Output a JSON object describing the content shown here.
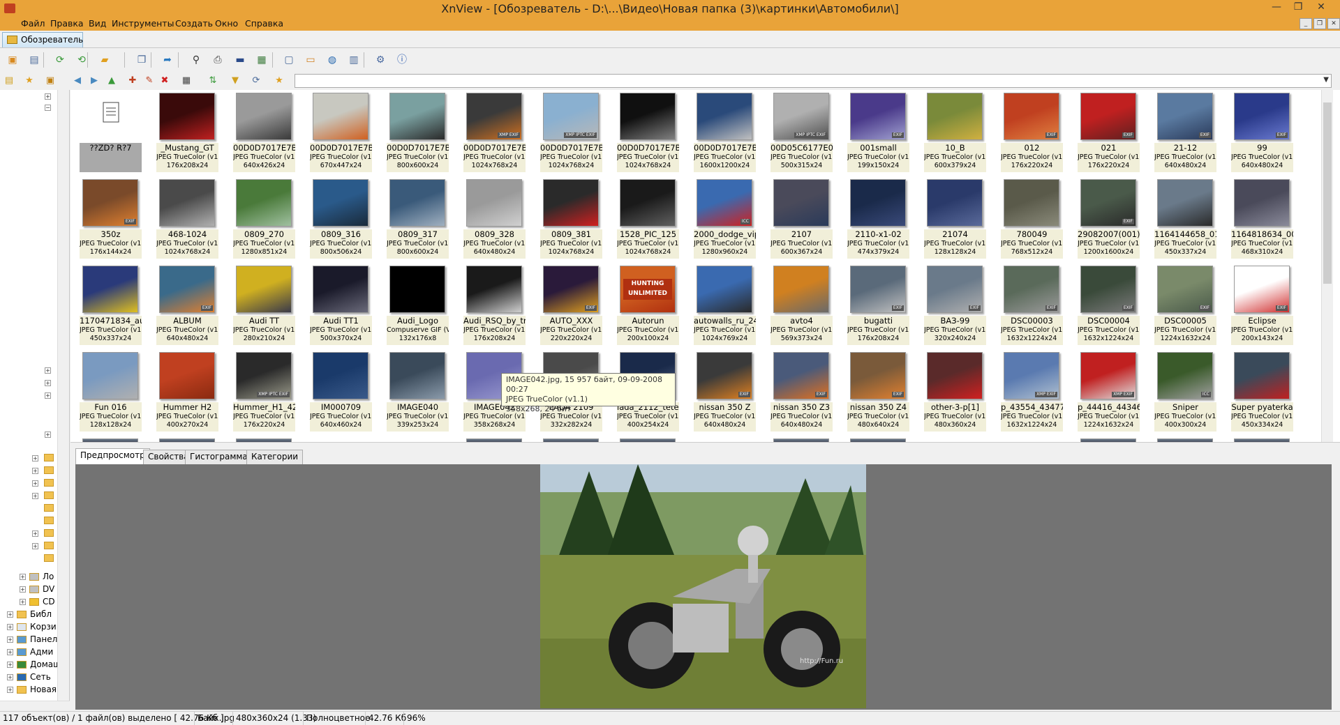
{
  "window": {
    "title": "XnView - [Обозреватель - D:\\...\\Видео\\Новая папка (3)\\картинки\\Автомобили\\]",
    "min": "—",
    "max": "❐",
    "close": "✕"
  },
  "menu": [
    "Файл",
    "Правка",
    "Вид",
    "Инструменты",
    "Создать",
    "Окно",
    "Справка"
  ],
  "mdi": {
    "min": "_",
    "restore": "❐",
    "close": "✕"
  },
  "tab": {
    "label": "Обозреватель"
  },
  "toolbar1": [
    {
      "name": "open-browser-icon",
      "glyph": "▣",
      "color": "#d88a20"
    },
    {
      "name": "fullscreen-icon",
      "glyph": "▤",
      "color": "#4a6a9a"
    },
    {
      "name": "refresh-icon",
      "glyph": "⟳",
      "color": "#3a9a3a"
    },
    {
      "name": "refresh-alt-icon",
      "glyph": "⟲",
      "color": "#3a9a3a"
    },
    {
      "name": "folder-open-icon",
      "glyph": "▰",
      "color": "#e0a020"
    },
    {
      "name": "copy-icon",
      "glyph": "❐",
      "color": "#4a6a9a"
    },
    {
      "name": "export-icon",
      "glyph": "➦",
      "color": "#2a7ac0"
    },
    {
      "name": "binoculars-icon",
      "glyph": "⚲",
      "color": "#333"
    },
    {
      "name": "print-icon",
      "glyph": "⎙",
      "color": "#444"
    },
    {
      "name": "scanner-icon",
      "glyph": "▬",
      "color": "#2a4a8a"
    },
    {
      "name": "slideshow-icon",
      "glyph": "▦",
      "color": "#3a7a3a"
    },
    {
      "name": "capture-icon",
      "glyph": "▢",
      "color": "#4a6a9a"
    },
    {
      "name": "monitor-icon",
      "glyph": "▭",
      "color": "#d08020"
    },
    {
      "name": "web-icon",
      "glyph": "◍",
      "color": "#2a6ab0"
    },
    {
      "name": "settings-grid-icon",
      "glyph": "▥",
      "color": "#4a6a9a"
    },
    {
      "name": "gear-icon",
      "glyph": "⚙",
      "color": "#4a6aa0"
    },
    {
      "name": "info-icon",
      "glyph": "ⓘ",
      "color": "#2a5ab0"
    }
  ],
  "toolbar2": [
    {
      "name": "tree-folders-icon",
      "glyph": "▤",
      "color": "#d0a020"
    },
    {
      "name": "favorites-icon",
      "glyph": "★",
      "color": "#e0a020"
    },
    {
      "name": "categories-icon",
      "glyph": "▣",
      "color": "#c08010"
    },
    {
      "name": "back-icon",
      "glyph": "◀",
      "color": "#4a8ac0"
    },
    {
      "name": "forward-icon",
      "glyph": "▶",
      "color": "#4a8ac0"
    },
    {
      "name": "up-icon",
      "glyph": "▲",
      "color": "#3a9a3a"
    },
    {
      "name": "new-folder-icon",
      "glyph": "✚",
      "color": "#c04020"
    },
    {
      "name": "rename-icon",
      "glyph": "✎",
      "color": "#c04020"
    },
    {
      "name": "delete-icon",
      "glyph": "✖",
      "color": "#d02020"
    },
    {
      "name": "view-mode-icon",
      "glyph": "▦",
      "color": "#444"
    },
    {
      "name": "sort-icon",
      "glyph": "⇅",
      "color": "#3a9a3a"
    },
    {
      "name": "filter-icon",
      "glyph": "▼",
      "color": "#d0a020"
    },
    {
      "name": "sync-icon",
      "glyph": "⟳",
      "color": "#4a6a9a"
    },
    {
      "name": "rating-icon",
      "glyph": "★",
      "color": "#e0a020"
    }
  ],
  "sidebar": {
    "items": [
      {
        "label": "Ло",
        "icon": "drive"
      },
      {
        "label": "DV",
        "icon": "drive"
      },
      {
        "label": "CD",
        "icon": "cd"
      },
      {
        "label": "Библ",
        "icon": "folder"
      },
      {
        "label": "Корзи",
        "icon": "bin"
      },
      {
        "label": "Панел",
        "icon": "panel"
      },
      {
        "label": "Адми",
        "icon": "panel"
      },
      {
        "label": "Домаш",
        "icon": "home"
      },
      {
        "label": "Сеть",
        "icon": "network"
      },
      {
        "label": "Новая",
        "icon": "folder"
      }
    ]
  },
  "files": [
    {
      "name": "??ZD? R?7",
      "fmt": "",
      "dim": "",
      "c1": "#ffffff",
      "c2": "#ffffff",
      "doc": true,
      "sel": true
    },
    {
      "name": "_Mustang_GT",
      "fmt": "JPEG TrueColor (v1.2)",
      "dim": "176x208x24",
      "c1": "#3a0a0a",
      "c2": "#c02020"
    },
    {
      "name": "00D0D7017E7B_2...",
      "fmt": "JPEG TrueColor (v1.1)",
      "dim": "640x426x24",
      "c1": "#9a9a9a",
      "c2": "#3a3a3a"
    },
    {
      "name": "00D0D7017E7B_2...",
      "fmt": "JPEG TrueColor (v1.2)",
      "dim": "670x447x24",
      "c1": "#c8c8c0",
      "c2": "#d06020"
    },
    {
      "name": "00D0D7017E7B_2...",
      "fmt": "JPEG TrueColor (v1.2)",
      "dim": "800x600x24",
      "c1": "#7aa0a0",
      "c2": "#2a2a2a"
    },
    {
      "name": "00D0D7017E7B_2...",
      "fmt": "JPEG TrueColor (v1.1)",
      "dim": "1024x768x24",
      "c1": "#3a3a3a",
      "c2": "#d07020",
      "badge": "XMP EXIF"
    },
    {
      "name": "00D0D7017E7B_2...",
      "fmt": "JPEG TrueColor (v1.1)",
      "dim": "1024x768x24",
      "c1": "#8ab0d0",
      "c2": "#b8b8b8",
      "badge": "XMP IPTC EXIF"
    },
    {
      "name": "00D0D7017E7B_2...",
      "fmt": "JPEG TrueColor (v1.1)",
      "dim": "1024x768x24",
      "c1": "#101010",
      "c2": "#808080"
    },
    {
      "name": "00D0D7017E7B_2...",
      "fmt": "JPEG TrueColor (v1.1)",
      "dim": "1600x1200x24",
      "c1": "#2a4a7a",
      "c2": "#c0c0c0"
    },
    {
      "name": "00D05C6177E0_8...",
      "fmt": "JPEG TrueColor (v1.2)",
      "dim": "500x315x24",
      "c1": "#b0b0b0",
      "c2": "#505050",
      "badge": "XMP IPTC EXIF"
    },
    {
      "name": "001small",
      "fmt": "JPEG TrueColor (v1.1)",
      "dim": "199x150x24",
      "c1": "#4a3a8a",
      "c2": "#a0a0d0",
      "badge": "EXIF"
    },
    {
      "name": "10_B",
      "fmt": "JPEG TrueColor (v1.1)",
      "dim": "600x379x24",
      "c1": "#7a8a3a",
      "c2": "#d0b040"
    },
    {
      "name": "012",
      "fmt": "JPEG TrueColor (v1.1)",
      "dim": "176x220x24",
      "c1": "#c04020",
      "c2": "#e08040",
      "badge": "EXIF"
    },
    {
      "name": "021",
      "fmt": "JPEG TrueColor (v1.1)",
      "dim": "176x220x24",
      "c1": "#c02020",
      "c2": "#602020",
      "badge": "EXIF"
    },
    {
      "name": "21-12",
      "fmt": "JPEG TrueColor (v1.1)",
      "dim": "640x480x24",
      "c1": "#5a7aa0",
      "c2": "#2a3a5a",
      "badge": "EXIF"
    },
    {
      "name": "99",
      "fmt": "JPEG TrueColor (v1.1)",
      "dim": "640x480x24",
      "c1": "#2a3a8a",
      "c2": "#6a7ad0",
      "badge": "EXIF"
    },
    {
      "name": "350z",
      "fmt": "JPEG TrueColor (v1.1)",
      "dim": "176x144x24",
      "c1": "#7a4a2a",
      "c2": "#e08030",
      "badge": "EXIF"
    },
    {
      "name": "468-1024",
      "fmt": "JPEG TrueColor (v1.1)",
      "dim": "1024x768x24",
      "c1": "#4a4a4a",
      "c2": "#b0b0b0"
    },
    {
      "name": "0809_270",
      "fmt": "JPEG TrueColor (v1.1)",
      "dim": "1280x851x24",
      "c1": "#4a7a3a",
      "c2": "#a0c0a0"
    },
    {
      "name": "0809_316",
      "fmt": "JPEG TrueColor (v1.2)",
      "dim": "800x506x24",
      "c1": "#2a5a8a",
      "c2": "#1a2a3a"
    },
    {
      "name": "0809_317",
      "fmt": "JPEG TrueColor (v1.2)",
      "dim": "800x600x24",
      "c1": "#3a5a7a",
      "c2": "#a0b0c0"
    },
    {
      "name": "0809_328",
      "fmt": "JPEG TrueColor (v1.1)",
      "dim": "640x480x24",
      "c1": "#9a9a9a",
      "c2": "#d0d0d0"
    },
    {
      "name": "0809_381",
      "fmt": "JPEG TrueColor (v1.1)",
      "dim": "1024x768x24",
      "c1": "#2a2a2a",
      "c2": "#d02020"
    },
    {
      "name": "1528_PIC_125",
      "fmt": "JPEG TrueColor (v1.1)",
      "dim": "1024x768x24",
      "c1": "#1a1a1a",
      "c2": "#606060"
    },
    {
      "name": "2000_dodge_vip...",
      "fmt": "JPEG TrueColor (v1.1)",
      "dim": "1280x960x24",
      "c1": "#3a6ab0",
      "c2": "#d02020",
      "badge": "ICC"
    },
    {
      "name": "2107",
      "fmt": "JPEG TrueColor (v1.1)",
      "dim": "600x367x24",
      "c1": "#4a4a5a",
      "c2": "#2a3a5a"
    },
    {
      "name": "2110-x1-02",
      "fmt": "JPEG TrueColor (v1.1)",
      "dim": "474x379x24",
      "c1": "#1a2a4a",
      "c2": "#3a4a7a"
    },
    {
      "name": "21074",
      "fmt": "JPEG TrueColor (v1.1)",
      "dim": "128x128x24",
      "c1": "#2a3a6a",
      "c2": "#5a6a9a"
    },
    {
      "name": "780049",
      "fmt": "JPEG TrueColor (v1.1)",
      "dim": "768x512x24",
      "c1": "#5a5a4a",
      "c2": "#8a8a7a"
    },
    {
      "name": "29082007(001)",
      "fmt": "JPEG TrueColor (v1.1)",
      "dim": "1200x1600x24",
      "c1": "#4a5a4a",
      "c2": "#2a2a2a",
      "badge": "EXIF"
    },
    {
      "name": "1164144658_01_v...",
      "fmt": "JPEG TrueColor (v1.1)",
      "dim": "450x337x24",
      "c1": "#6a7a8a",
      "c2": "#2a2a2a"
    },
    {
      "name": "1164818634_0090...",
      "fmt": "JPEG TrueColor (v1.2)",
      "dim": "468x310x24",
      "c1": "#4a4a5a",
      "c2": "#8a8a9a"
    },
    {
      "name": "1170471834_auto...",
      "fmt": "JPEG TrueColor (v1.1)",
      "dim": "450x337x24",
      "c1": "#2a3a7a",
      "c2": "#e0c020"
    },
    {
      "name": "ALBUM",
      "fmt": "JPEG TrueColor (v1.1)",
      "dim": "640x480x24",
      "c1": "#3a6a8a",
      "c2": "#e08030",
      "badge": "EXIF"
    },
    {
      "name": "Audi TT",
      "fmt": "JPEG TrueColor (v1.1)",
      "dim": "280x210x24",
      "c1": "#d0b020",
      "c2": "#3a3a4a"
    },
    {
      "name": "Audi TT1",
      "fmt": "JPEG TrueColor (v1.1)",
      "dim": "500x370x24",
      "c1": "#1a1a2a",
      "c2": "#6a6a7a"
    },
    {
      "name": "Audi_Logo",
      "fmt": "Compuserve GIF (V...",
      "dim": "132x176x8",
      "c1": "#000000",
      "c2": "#000000"
    },
    {
      "name": "Audi_RSQ_by_tr...",
      "fmt": "JPEG TrueColor (v1.1)",
      "dim": "176x208x24",
      "c1": "#1a1a1a",
      "c2": "#d0d0d0"
    },
    {
      "name": "AUTO_XXX",
      "fmt": "JPEG TrueColor (v1.1)",
      "dim": "220x220x24",
      "c1": "#2a1a3a",
      "c2": "#e0a020",
      "badge": "EXIF"
    },
    {
      "name": "Autorun",
      "fmt": "JPEG TrueColor (v1.1)",
      "dim": "200x100x24",
      "c1": "#d06020",
      "c2": "#b03010",
      "hunt": true
    },
    {
      "name": "autowalls_ru_242",
      "fmt": "JPEG TrueColor (v1.1)",
      "dim": "1024x769x24",
      "c1": "#3a6ab0",
      "c2": "#2a2a2a"
    },
    {
      "name": "avto4",
      "fmt": "JPEG TrueColor (v1.1)",
      "dim": "569x373x24",
      "c1": "#d08020",
      "c2": "#6a6a6a"
    },
    {
      "name": "bugatti",
      "fmt": "JPEG TrueColor (v1.2)",
      "dim": "176x208x24",
      "c1": "#5a6a7a",
      "c2": "#c0c0c0",
      "badge": "EXIF"
    },
    {
      "name": "ВАЗ-99",
      "fmt": "JPEG TrueColor (v1.1)",
      "dim": "320x240x24",
      "c1": "#6a7a8a",
      "c2": "#b0b0b0",
      "badge": "EXIF"
    },
    {
      "name": "DSC00003",
      "fmt": "JPEG TrueColor (v1.1)",
      "dim": "1632x1224x24",
      "c1": "#5a6a5a",
      "c2": "#9a9a9a",
      "badge": "EXIF"
    },
    {
      "name": "DSC00004",
      "fmt": "JPEG TrueColor (v1.1)",
      "dim": "1632x1224x24",
      "c1": "#3a4a3a",
      "c2": "#7a7a7a",
      "badge": "EXIF"
    },
    {
      "name": "DSC00005",
      "fmt": "JPEG TrueColor (v1.1)",
      "dim": "1224x1632x24",
      "c1": "#7a8a6a",
      "c2": "#4a5a4a",
      "badge": "EXIF"
    },
    {
      "name": "Eclipse",
      "fmt": "JPEG TrueColor (v1.1)",
      "dim": "200x143x24",
      "c1": "#ffffff",
      "c2": "#d03030",
      "badge": "EXIF"
    },
    {
      "name": "Fun 016",
      "fmt": "JPEG TrueColor (v1.1)",
      "dim": "128x128x24",
      "c1": "#7a9ac0",
      "c2": "#b0b0b0"
    },
    {
      "name": "Hummer H2",
      "fmt": "JPEG TrueColor (v1.1)",
      "dim": "400x270x24",
      "c1": "#c04020",
      "c2": "#8a2a10"
    },
    {
      "name": "Hummer_H1_42...",
      "fmt": "JPEG TrueColor (v1.2)",
      "dim": "176x220x24",
      "c1": "#2a2a2a",
      "c2": "#9a9a8a",
      "badge": "XMP IPTC EXIF"
    },
    {
      "name": "IM000709",
      "fmt": "JPEG TrueColor (v1.1)",
      "dim": "640x460x24",
      "c1": "#1a3a6a",
      "c2": "#3a5a8a"
    },
    {
      "name": "IMAGE040",
      "fmt": "JPEG TrueColor (v1.1)",
      "dim": "339x253x24",
      "c1": "#3a4a5a",
      "c2": "#8a9aaa"
    },
    {
      "name": "IMAGE042",
      "fmt": "JPEG TrueColor (v1.1)",
      "dim": "358x268x24",
      "c1": "#6a6ab0",
      "c2": "#9a9ad0"
    },
    {
      "name": "LADA 2109",
      "fmt": "JPEG TrueColor (v1.1)",
      "dim": "332x282x24",
      "c1": "#4a4a4a",
      "c2": "#8a8a8a"
    },
    {
      "name": "lada_2112_teter_2",
      "fmt": "JPEG TrueColor (v1.1)",
      "dim": "400x254x24",
      "c1": "#1a2a4a",
      "c2": "#5a6a8a"
    },
    {
      "name": "nissan 350 Z",
      "fmt": "JPEG TrueColor (v1.1)",
      "dim": "640x480x24",
      "c1": "#3a3a3a",
      "c2": "#e08020",
      "badge": "EXIF"
    },
    {
      "name": "nissan 350 Z3",
      "fmt": "JPEG TrueColor (v1.1)",
      "dim": "640x480x24",
      "c1": "#4a5a7a",
      "c2": "#e07020",
      "badge": "EXIF"
    },
    {
      "name": "nissan 350 Z4",
      "fmt": "JPEG TrueColor (v1.1)",
      "dim": "480x640x24",
      "c1": "#7a5a3a",
      "c2": "#e08030",
      "badge": "EXIF"
    },
    {
      "name": "other-3-p[1]",
      "fmt": "JPEG TrueColor (v1.2)",
      "dim": "480x360x24",
      "c1": "#5a2a2a",
      "c2": "#d02020"
    },
    {
      "name": "p_43554_43477",
      "fmt": "JPEG TrueColor (v1.2)",
      "dim": "1632x1224x24",
      "c1": "#5a7ab0",
      "c2": "#b0c0d0",
      "badge": "XMP EXIF"
    },
    {
      "name": "p_44416_44346",
      "fmt": "JPEG TrueColor (v1.1)",
      "dim": "1224x1632x24",
      "c1": "#c02020",
      "c2": "#e0e0e0",
      "badge": "XMP EXIF"
    },
    {
      "name": "Sniper",
      "fmt": "JPEG TrueColor (v1.1)",
      "dim": "400x300x24",
      "c1": "#3a5a2a",
      "c2": "#a0a0a0",
      "badge": "ICC"
    },
    {
      "name": "Super pyaterka",
      "fmt": "JPEG TrueColor (v1.1)",
      "dim": "450x334x24",
      "c1": "#3a4a5a",
      "c2": "#c02020"
    }
  ],
  "tooltip": {
    "line1": "IMAGE042.jpg, 15 957 байт, 09-09-2008 00:27",
    "line2": "JPEG TrueColor (v1.1)",
    "line3": "358x268, 24 бит"
  },
  "preview_tabs": [
    "Предпросмотр",
    "Свойства",
    "Гистограмма",
    "Категории"
  ],
  "preview": {
    "watermark": "http://Fun.ru"
  },
  "status": [
    "117 объект(ов) / 1 файл(ов) выделено  [ 42.76 Кб ]",
    "Байк.jpg",
    "480x360x24 (1.33)",
    "Полноцветное",
    "42.76 Кб",
    "96%"
  ]
}
